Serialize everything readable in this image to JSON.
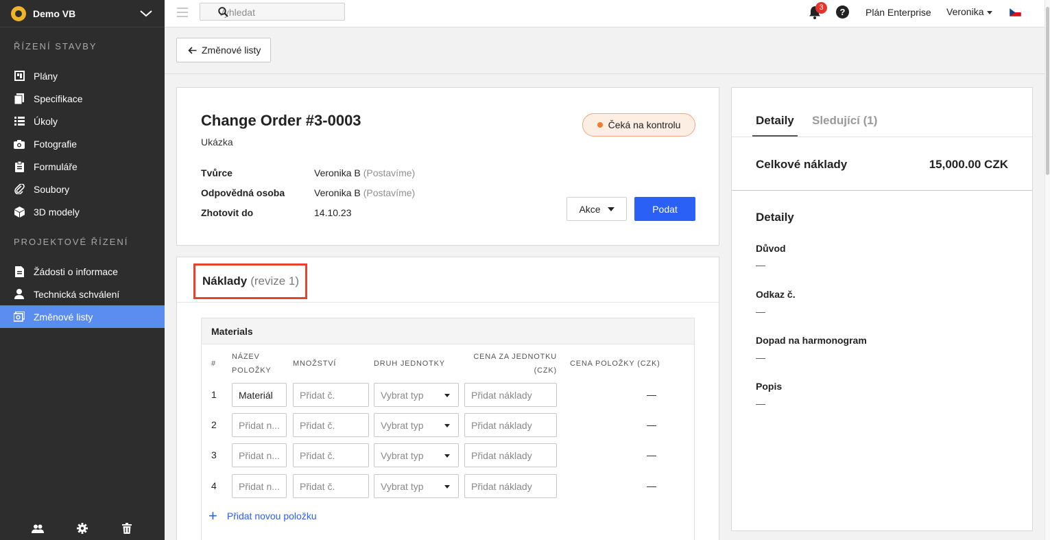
{
  "app": {
    "workspace": "Demo VB"
  },
  "sidebar": {
    "section1": "ŘÍZENÍ STAVBY",
    "items1": [
      {
        "label": "Plány",
        "icon": "plans-icon"
      },
      {
        "label": "Specifikace",
        "icon": "specs-icon"
      },
      {
        "label": "Úkoly",
        "icon": "tasks-icon"
      },
      {
        "label": "Fotografie",
        "icon": "camera-icon"
      },
      {
        "label": "Formuláře",
        "icon": "forms-icon"
      },
      {
        "label": "Soubory",
        "icon": "paperclip-icon"
      },
      {
        "label": "3D modely",
        "icon": "cube-icon"
      }
    ],
    "section2": "PROJEKTOVÉ ŘÍZENÍ",
    "items2": [
      {
        "label": "Žádosti o informace",
        "icon": "rfi-icon"
      },
      {
        "label": "Technická schválení",
        "icon": "person-icon"
      },
      {
        "label": "Změnové listy",
        "icon": "change-order-icon",
        "active": true
      }
    ]
  },
  "topbar": {
    "search_placeholder": "Vyhledat",
    "notifications_count": "3",
    "help": "?",
    "plan": "Plán Enterprise",
    "user": "Veronika"
  },
  "back": {
    "label": "Změnové listy"
  },
  "change_order": {
    "title": "Change Order #3-0003",
    "subtitle": "Ukázka",
    "status": "Čeká na kontrolu",
    "creator_label": "Tvůrce",
    "creator_name": "Veronika B",
    "creator_org": "(Postavíme)",
    "responsible_label": "Odpovědná osoba",
    "responsible_name": "Veronika B",
    "responsible_org": "(Postavíme)",
    "due_label": "Zhotovit do",
    "due_value": "14.10.23",
    "actions_label": "Akce",
    "submit_label": "Podat"
  },
  "costs": {
    "title": "Náklady",
    "revision": "(revize 1)",
    "group": "Materials",
    "columns": [
      "#",
      "NÁZEV POLOŽKY",
      "MNOŽSTVÍ",
      "DRUH JEDNOTKY",
      "CENA ZA JEDNOTKU (CZK)",
      "CENA POLOŽKY (CZK)"
    ],
    "rows": [
      {
        "num": "1",
        "name": "Materiál",
        "name_filled": true,
        "qty": "Přidat č.",
        "unit": "Vybrat typ",
        "price": "Přidat náklady",
        "total": "—"
      },
      {
        "num": "2",
        "name": "Přidat n...",
        "name_filled": false,
        "qty": "Přidat č.",
        "unit": "Vybrat typ",
        "price": "Přidat náklady",
        "total": "—"
      },
      {
        "num": "3",
        "name": "Přidat n...",
        "name_filled": false,
        "qty": "Přidat č.",
        "unit": "Vybrat typ",
        "price": "Přidat náklady",
        "total": "—"
      },
      {
        "num": "4",
        "name": "Přidat n...",
        "name_filled": false,
        "qty": "Přidat č.",
        "unit": "Vybrat typ",
        "price": "Přidat náklady",
        "total": "—"
      }
    ],
    "add_item": "Přidat novou položku"
  },
  "details_panel": {
    "tab_details": "Detaily",
    "tab_followers": "Sledující (1)",
    "total_label": "Celkové náklady",
    "total_value": "15,000.00 CZK",
    "section_title": "Detaily",
    "fields": [
      {
        "label": "Důvod",
        "value": "—"
      },
      {
        "label": "Odkaz č.",
        "value": "—"
      },
      {
        "label": "Dopad na harmonogram",
        "value": "—"
      },
      {
        "label": "Popis",
        "value": "—"
      }
    ]
  },
  "colors": {
    "accent": "#2a60f5",
    "active_nav": "#5b8df0",
    "sidebar_bg": "#2d2d2d",
    "status_dot": "#f27b2f",
    "highlight_border": "#e8412c",
    "badge": "#e5342a"
  }
}
